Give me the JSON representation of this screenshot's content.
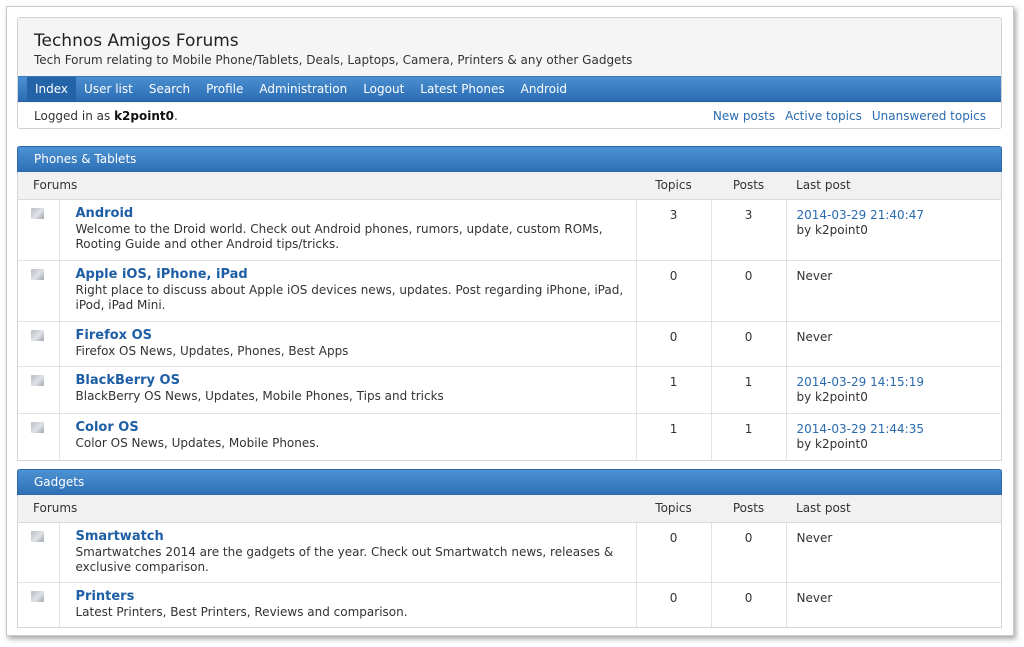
{
  "site": {
    "title": "Technos Amigos Forums",
    "description": "Tech Forum relating to Mobile Phone/Tablets, Deals, Laptops, Camera, Printers & any other Gadgets"
  },
  "nav": {
    "items": [
      "Index",
      "User list",
      "Search",
      "Profile",
      "Administration",
      "Logout",
      "Latest Phones",
      "Android"
    ],
    "active": "Index"
  },
  "status": {
    "logged_prefix": "Logged in as",
    "username": "k2point0",
    "suffix": "."
  },
  "quicklinks": [
    "New posts",
    "Active topics",
    "Unanswered topics"
  ],
  "columns": {
    "forum": "Forums",
    "topics": "Topics",
    "posts": "Posts",
    "last": "Last post"
  },
  "categories": [
    {
      "title": "Phones & Tablets",
      "forums": [
        {
          "name": "Android",
          "desc": "Welcome to the Droid world. Check out Android phones, rumors, update, custom ROMs, Rooting Guide and other Android tips/tricks.",
          "topics": "3",
          "posts": "3",
          "last_date": "2014-03-29 21:40:47",
          "last_by": "by k2point0"
        },
        {
          "name": "Apple iOS, iPhone, iPad",
          "desc": "Right place to discuss about Apple iOS devices news, updates. Post regarding iPhone, iPad, iPod, iPad Mini.",
          "topics": "0",
          "posts": "0",
          "last_text": "Never"
        },
        {
          "name": "Firefox OS",
          "desc": "Firefox OS News, Updates, Phones, Best Apps",
          "topics": "0",
          "posts": "0",
          "last_text": "Never"
        },
        {
          "name": "BlackBerry OS",
          "desc": "BlackBerry OS News, Updates, Mobile Phones, Tips and tricks",
          "topics": "1",
          "posts": "1",
          "last_date": "2014-03-29 14:15:19",
          "last_by": "by k2point0"
        },
        {
          "name": "Color OS",
          "desc": "Color OS News, Updates, Mobile Phones.",
          "topics": "1",
          "posts": "1",
          "last_date": "2014-03-29 21:44:35",
          "last_by": "by k2point0"
        }
      ]
    },
    {
      "title": "Gadgets",
      "forums": [
        {
          "name": "Smartwatch",
          "desc": "Smartwatches 2014 are the gadgets of the year. Check out Smartwatch news, releases & exclusive comparison.",
          "topics": "0",
          "posts": "0",
          "last_text": "Never"
        },
        {
          "name": "Printers",
          "desc": "Latest Printers, Best Printers, Reviews and comparison.",
          "topics": "0",
          "posts": "0",
          "last_text": "Never"
        }
      ]
    }
  ],
  "colors": {
    "nav_blue": "#2b6cb3",
    "link_blue": "#1d5ea5",
    "header_bg": "#f5f5f5"
  },
  "icons": {
    "forum_status": "forum-status-icon"
  }
}
